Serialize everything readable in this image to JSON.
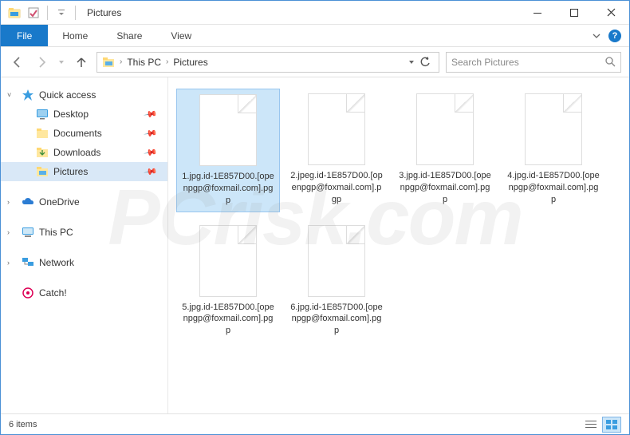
{
  "window": {
    "title": "Pictures"
  },
  "ribbon": {
    "file": "File",
    "tabs": [
      "Home",
      "Share",
      "View"
    ]
  },
  "breadcrumb": {
    "root_sep": "›",
    "items": [
      "This PC",
      "Pictures"
    ]
  },
  "search": {
    "placeholder": "Search Pictures"
  },
  "sidebar": {
    "quickaccess": {
      "label": "Quick access"
    },
    "quick_items": [
      {
        "label": "Desktop",
        "icon": "desktop"
      },
      {
        "label": "Documents",
        "icon": "folder"
      },
      {
        "label": "Downloads",
        "icon": "folder"
      },
      {
        "label": "Pictures",
        "icon": "folder",
        "active": true
      }
    ],
    "onedrive": {
      "label": "OneDrive"
    },
    "thispc": {
      "label": "This PC"
    },
    "network": {
      "label": "Network"
    },
    "catch": {
      "label": "Catch!"
    }
  },
  "files": [
    {
      "name": "1.jpg.id-1E857D00.[openpgp@foxmail.com].pgp",
      "selected": true
    },
    {
      "name": "2.jpeg.id-1E857D00.[openpgp@foxmail.com].pgp"
    },
    {
      "name": "3.jpg.id-1E857D00.[openpgp@foxmail.com].pgp"
    },
    {
      "name": "4.jpg.id-1E857D00.[openpgp@foxmail.com].pgp"
    },
    {
      "name": "5.jpg.id-1E857D00.[openpgp@foxmail.com].pgp"
    },
    {
      "name": "6.jpg.id-1E857D00.[openpgp@foxmail.com].pgp"
    }
  ],
  "statusbar": {
    "count_label": "6 items"
  },
  "watermark": "PCrisk.com"
}
